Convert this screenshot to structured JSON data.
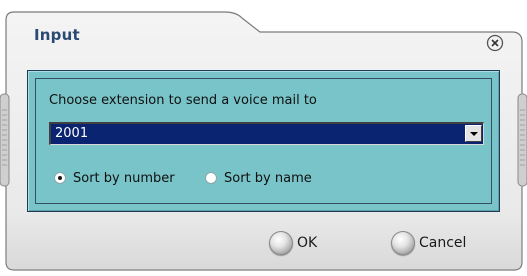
{
  "dialog": {
    "title": "Input",
    "close_icon": "close-circle-icon"
  },
  "form": {
    "prompt": "Choose extension to send a voice mail to",
    "extension_select": {
      "value": "2001"
    },
    "sort_options": [
      {
        "label": "Sort by number",
        "checked": true
      },
      {
        "label": "Sort by name",
        "checked": false
      }
    ]
  },
  "buttons": {
    "ok_label": "OK",
    "cancel_label": "Cancel"
  },
  "colors": {
    "panel": "#78c4c8",
    "select_background": "#0a2472",
    "title": "#2b4a72"
  }
}
